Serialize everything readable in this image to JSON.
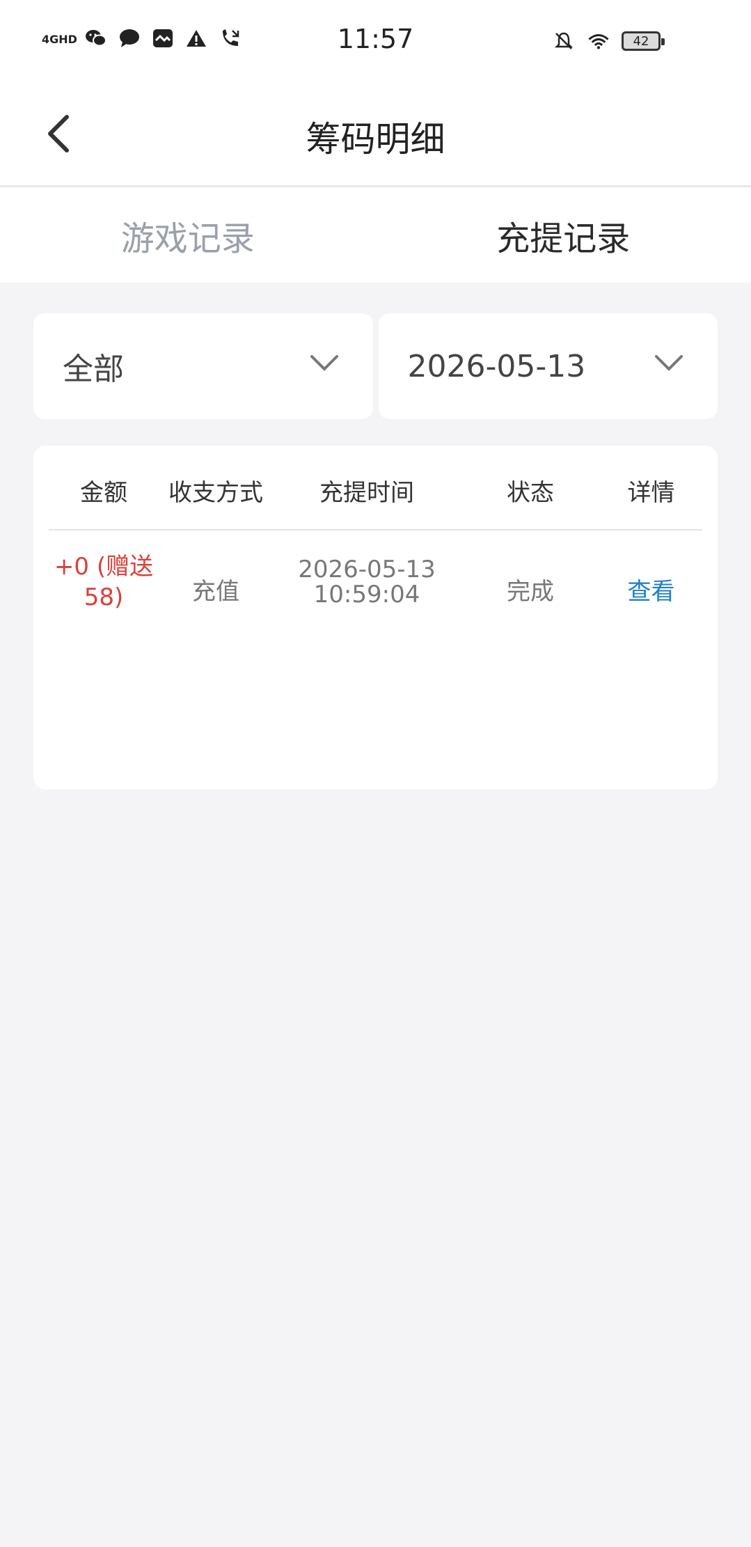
{
  "status_bar": {
    "signal": "4GHD",
    "time": "11:57",
    "battery": "42"
  },
  "header": {
    "title": "筹码明细"
  },
  "tabs": [
    {
      "label": "游戏记录",
      "active": false
    },
    {
      "label": "充提记录",
      "active": true
    }
  ],
  "filters": {
    "type": "全部",
    "date": "2026-05-13"
  },
  "table": {
    "headers": [
      "金额",
      "收支方式",
      "充提时间",
      "状态",
      "详情"
    ],
    "rows": [
      {
        "amount": "+0 (赠送 58)",
        "method": "充值",
        "date": "2026-05-13",
        "time": "10:59:04",
        "status": "完成",
        "detail": "查看"
      }
    ]
  },
  "colors": {
    "amount": "#d9403a",
    "link": "#1e7fc8",
    "background": "#f4f4f6"
  }
}
